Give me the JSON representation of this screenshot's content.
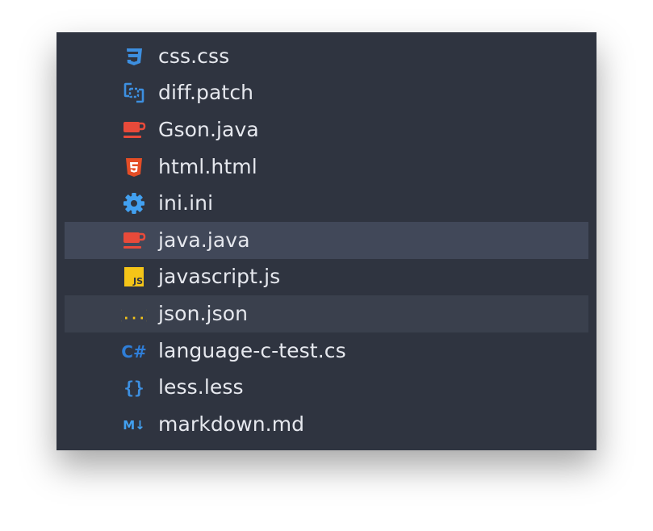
{
  "files": [
    {
      "name": "css.css",
      "icon": "css-icon",
      "color": "#3d8fe0"
    },
    {
      "name": "diff.patch",
      "icon": "diff-icon",
      "color": "#3d8fe0"
    },
    {
      "name": "Gson.java",
      "icon": "java-icon",
      "color": "#e84a3a"
    },
    {
      "name": "html.html",
      "icon": "html-icon",
      "color": "#e44d26"
    },
    {
      "name": "ini.ini",
      "icon": "gear-icon",
      "color": "#42a0f0"
    },
    {
      "name": "java.java",
      "icon": "java-icon",
      "color": "#e84a3a",
      "state": "selected"
    },
    {
      "name": "javascript.js",
      "icon": "javascript-icon",
      "color": "#f5c518"
    },
    {
      "name": "json.json",
      "icon": "json-icon",
      "color": "#f5c518",
      "state": "hover"
    },
    {
      "name": "language-c-test.cs",
      "icon": "csharp-icon",
      "color": "#2f7ed8"
    },
    {
      "name": "less.less",
      "icon": "less-icon",
      "color": "#3d8fe0"
    },
    {
      "name": "markdown.md",
      "icon": "markdown-icon",
      "color": "#42a0f0"
    }
  ],
  "icon_text": {
    "javascript": "JS",
    "csharp": "C#",
    "less": "{}",
    "json": "{...}",
    "markdown": "M↓"
  }
}
